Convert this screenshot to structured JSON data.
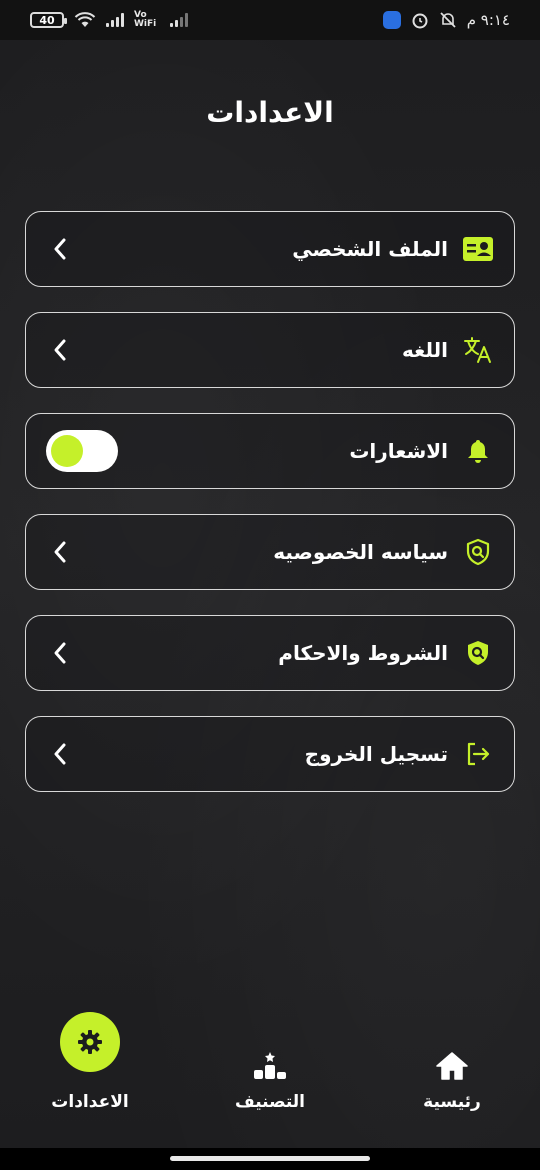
{
  "status_bar": {
    "battery": "40",
    "network_label": "Vo WiFi",
    "time": "٩:١٤ م"
  },
  "page": {
    "title": "الاعدادات"
  },
  "menu": {
    "items": [
      {
        "label": "الملف الشخصي",
        "icon": "id-card-icon",
        "control": "chevron-left"
      },
      {
        "label": "اللغه",
        "icon": "translate-icon",
        "control": "chevron-left"
      },
      {
        "label": "الاشعارات",
        "icon": "bell-icon",
        "control": "toggle"
      },
      {
        "label": "سياسه الخصوصيه",
        "icon": "shield-search-icon",
        "control": "chevron-left"
      },
      {
        "label": "الشروط والاحكام",
        "icon": "shield-search-icon",
        "control": "chevron-left"
      },
      {
        "label": "تسجيل الخروج",
        "icon": "logout-icon",
        "control": "chevron-left"
      }
    ],
    "notifications_enabled": false
  },
  "bottom_nav": {
    "settings": "الاعدادات",
    "ranking": "التصنيف",
    "home": "رئيسية",
    "active": "settings"
  },
  "colors": {
    "accent": "#c5f02a",
    "background": "#1c1c1e",
    "border": "#d8d8d8"
  }
}
